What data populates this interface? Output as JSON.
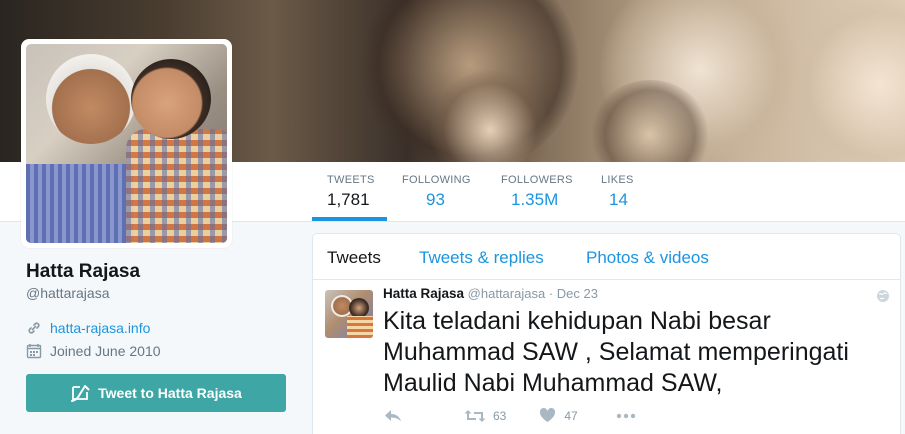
{
  "profile": {
    "name": "Hatta Rajasa",
    "handle": "@hattarajasa",
    "website": "hatta-rajasa.info",
    "joined": "Joined June 2010",
    "tweet_to_label": "Tweet to Hatta Rajasa"
  },
  "stats": [
    {
      "label": "TWEETS",
      "value": "1,781"
    },
    {
      "label": "FOLLOWING",
      "value": "93"
    },
    {
      "label": "FOLLOWERS",
      "value": "1.35M"
    },
    {
      "label": "LIKES",
      "value": "14"
    }
  ],
  "tabs": [
    "Tweets",
    "Tweets & replies",
    "Photos & videos"
  ],
  "tweet": {
    "name": "Hatta Rajasa",
    "handle": "@hattarajasa",
    "dot": "·",
    "date": "Dec 23",
    "text": "Kita teladani kehidupan  Nabi besar Muhammad SAW , Selamat memperingati Maulid Nabi Muhammad SAW,",
    "retweets": "63",
    "likes": "47"
  },
  "colors": {
    "accent": "#1b95e0",
    "button": "#3ea6a4",
    "muted": "#657786"
  },
  "icons": {
    "link": "link-icon",
    "calendar": "calendar-icon",
    "compose": "compose-tweet-icon",
    "reply": "reply-icon",
    "retweet": "retweet-icon",
    "like": "heart-icon",
    "more": "more-dots-icon",
    "globe": "globe-icon"
  }
}
